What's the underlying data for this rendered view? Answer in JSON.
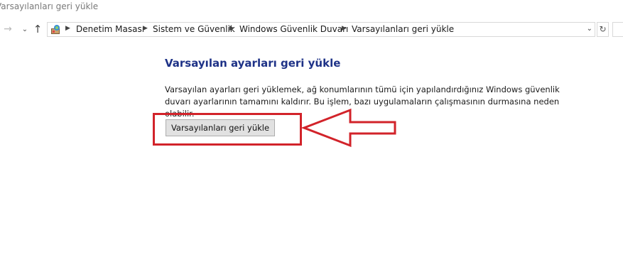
{
  "window": {
    "title": "Varsayılanları geri yükle"
  },
  "navigation": {
    "forward_icon": "arrow-right-icon",
    "recent_icon": "chevron-down-icon",
    "up_icon": "arrow-up-icon",
    "breadcrumbs": [
      "Denetim Masası",
      "Sistem ve Güvenlik",
      "Windows Güvenlik Duvarı",
      "Varsayılanları geri yükle"
    ],
    "refresh_icon": "refresh-icon"
  },
  "main": {
    "title": "Varsayılan ayarları geri yükle",
    "description": "Varsayılan ayarları geri yüklemek, ağ konumlarının tümü için yapılandırdığınız Windows güvenlik duvarı ayarlarının tamamını kaldırır. Bu işlem, bazı uygulamaların çalışmasının durmasına neden olabilir.",
    "restore_button_label": "Varsayılanları geri yükle"
  },
  "annotation": {
    "color": "#d2232a",
    "highlight": "red-rectangle",
    "arrow": "red-arrow-pointing-left"
  }
}
